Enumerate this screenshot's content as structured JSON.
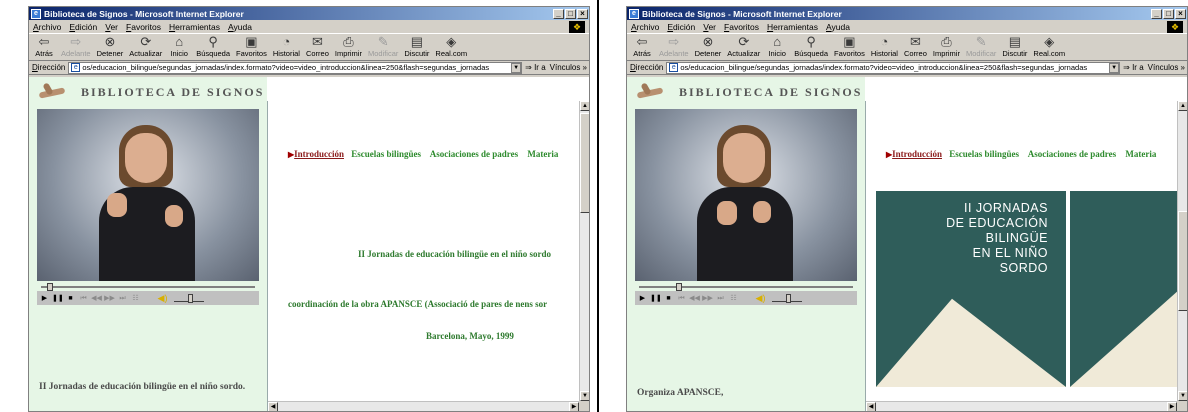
{
  "window": {
    "title": "Biblioteca de Signos - Microsoft Internet Explorer",
    "controls": {
      "minimize": "_",
      "maximize": "□",
      "close": "×"
    }
  },
  "menu": [
    "Archivo",
    "Edición",
    "Ver",
    "Favoritos",
    "Herramientas",
    "Ayuda"
  ],
  "toolbar": {
    "back": "Atrás",
    "forward": "Adelante",
    "stop": "Detener",
    "refresh": "Actualizar",
    "home": "Inicio",
    "search": "Búsqueda",
    "favorites": "Favoritos",
    "history": "Historial",
    "mail": "Correo",
    "print": "Imprimir",
    "edit": "Modificar",
    "discuss": "Discutir",
    "realcom": "Real.com"
  },
  "address": {
    "label": "Dirección",
    "url": "os/educacion_bilingue/segundas_jornadas/index.formato?video=video_introduccion&linea=250&flash=segundas_jornadas",
    "go": "Ir a",
    "links": "Vínculos »"
  },
  "site": {
    "logo_text": "BIBLIOTECA DE SIGNOS"
  },
  "nav": {
    "items": [
      "Introducción",
      "Escuelas bilingües",
      "Asociaciones de padres",
      "Materia"
    ],
    "active": "Introducción"
  },
  "left_frame": {
    "seek_fraction": 0.03,
    "left_text": "II Jornadas de educación bilingüe en el niño sordo.",
    "main_lines": [
      "II Jornadas de educación bilingüe en el niño sordo",
      "coordinación de la obra APANSCE (Associació de pares de nens sor",
      "Barcelona, Mayo, 1999"
    ]
  },
  "right_frame": {
    "seek_fraction": 0.18,
    "left_text": "Organiza APANSCE,",
    "poster_title": "II JORNADAS\nDE EDUCACIÓN\nBILINGÜE\nEN EL NIÑO\nSORDO"
  },
  "colors": {
    "titlebar_start": "#0a246a",
    "left_pane_bg": "#e6f6e6",
    "nav_green": "#2e8b2e",
    "nav_active": "#8b1a1a",
    "poster_teal": "#2f5d5a"
  }
}
